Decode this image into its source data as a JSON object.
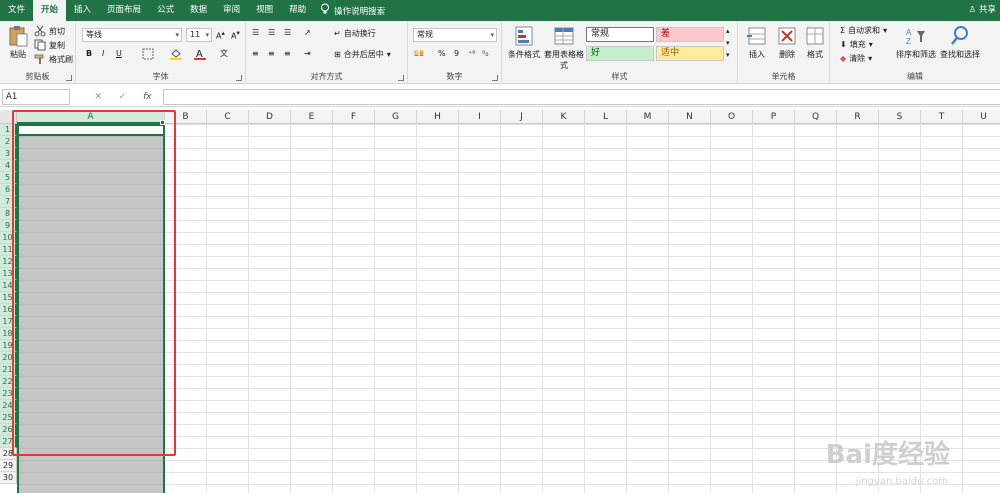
{
  "tabs": [
    "文件",
    "开始",
    "插入",
    "页面布局",
    "公式",
    "数据",
    "审阅",
    "视图",
    "帮助"
  ],
  "active_tab": "开始",
  "tell_me": "操作说明搜索",
  "share": "共享",
  "clipboard": {
    "paste": "粘贴",
    "cut": "剪切",
    "copy": "复制",
    "format_painter": "格式刷",
    "label": "剪贴板"
  },
  "font": {
    "name": "等线",
    "size": "11",
    "bold": "B",
    "italic": "I",
    "underline": "U",
    "label": "字体",
    "accent_red": "#e8392f",
    "highlight_yellow": "#ffd400"
  },
  "alignment": {
    "wrap": "自动换行",
    "merge": "合并后居中",
    "label": "对齐方式"
  },
  "number": {
    "format": "常规",
    "percent": "%",
    "comma": "9",
    "label": "数字"
  },
  "styles": {
    "conditional": "条件格式",
    "table_format": "套用表格格式",
    "normal": "常规",
    "bad": "差",
    "good": "好",
    "neutral": "适中",
    "label": "样式"
  },
  "cells": {
    "insert": "插入",
    "delete": "删除",
    "format": "格式",
    "label": "单元格"
  },
  "editing": {
    "autosum": "自动求和",
    "fill": "填充",
    "clear": "清除",
    "sort": "排序和筛选",
    "find": "查找和选择",
    "label": "编辑"
  },
  "formula_bar": {
    "name_box": "A1",
    "cancel": "✕",
    "enter": "✓",
    "fx": "fx"
  },
  "columns": [
    "A",
    "B",
    "C",
    "D",
    "E",
    "F",
    "G",
    "H",
    "I",
    "J",
    "K",
    "L",
    "M",
    "N",
    "O",
    "P",
    "Q",
    "R",
    "S",
    "T",
    "U"
  ],
  "rows": [
    "1",
    "2",
    "3",
    "4",
    "5",
    "6",
    "7",
    "8",
    "9",
    "10",
    "11",
    "12",
    "13",
    "14",
    "15",
    "16",
    "17",
    "18",
    "19",
    "20",
    "21",
    "22",
    "23",
    "24",
    "25",
    "26",
    "27",
    "28",
    "29",
    "30"
  ],
  "selected_column": "A",
  "colors": {
    "brand": "#217346",
    "selection_gray": "#c6c6c6",
    "annotation_red": "#e53935"
  },
  "watermark": {
    "main": "Bai度经验",
    "url": "jingyan.baidu.com"
  }
}
